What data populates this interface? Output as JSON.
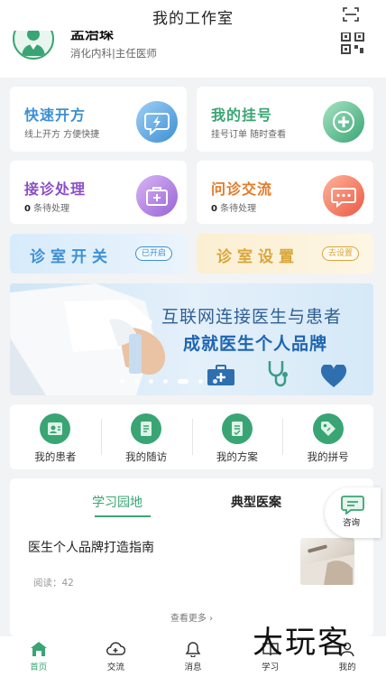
{
  "header": {
    "title": "我的工作室"
  },
  "profile": {
    "name": "孟治琛",
    "department": "消化内科",
    "title": "主任医师"
  },
  "cards": [
    {
      "title": "快速开方",
      "subtitle": "线上开方 方便快捷",
      "color": "#3d8fd4"
    },
    {
      "title": "我的挂号",
      "subtitle": "挂号订单 随时查看",
      "color": "#3aa574"
    },
    {
      "title": "接诊处理",
      "count": "0",
      "subtitle": "条待处理",
      "color": "#8b4fc6"
    },
    {
      "title": "问诊交流",
      "count": "0",
      "subtitle": "条待处理",
      "color": "#e07c2c"
    }
  ],
  "switches": [
    {
      "label": "诊室开关",
      "badge": "已开启",
      "color": "#3d8fd4"
    },
    {
      "label": "诊室设置",
      "badge": "去设置",
      "color": "#d9a63a"
    }
  ],
  "banner": {
    "line1": "互联网连接医生与患者",
    "line2": "成就医生个人品牌"
  },
  "quick_actions": [
    {
      "label": "我的患者",
      "icon": "patient-icon"
    },
    {
      "label": "我的随访",
      "icon": "followup-icon"
    },
    {
      "label": "我的方案",
      "icon": "plan-icon"
    },
    {
      "label": "我的拼号",
      "icon": "tag-icon"
    }
  ],
  "learning": {
    "tabs": [
      "学习园地",
      "典型医案"
    ],
    "article": {
      "title": "医生个人品牌打造指南",
      "reads_label": "阅读：",
      "reads": "42"
    },
    "more": "查看更多"
  },
  "consult": {
    "label": "咨询"
  },
  "tabbar": [
    {
      "label": "首页",
      "active": true
    },
    {
      "label": "交流"
    },
    {
      "label": "消息"
    },
    {
      "label": "学习"
    },
    {
      "label": "我的"
    }
  ],
  "watermark": "大玩客",
  "colors": {
    "brand": "#3aa574",
    "blue": "#3d8fd4",
    "purple": "#8b4fc6",
    "orange": "#e07c2c",
    "gold": "#d9a63a"
  }
}
